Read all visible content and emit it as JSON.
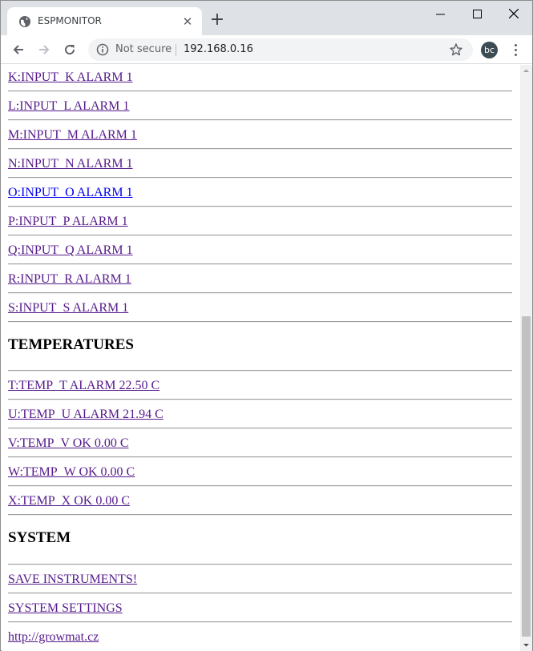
{
  "browser": {
    "tab_title": "ESPMONITOR",
    "tab_close": "✕",
    "new_tab": "+",
    "security_label": "Not secure",
    "url": "192.168.0.16",
    "profile_initials": "bc"
  },
  "page": {
    "input_links": [
      "K:INPUT_K ALARM 1",
      "L:INPUT_L ALARM 1",
      "M:INPUT_M ALARM 1",
      "N:INPUT_N ALARM 1",
      "O:INPUT_O ALARM 1",
      "P:INPUT_P ALARM 1",
      "Q:INPUT_Q ALARM 1",
      "R:INPUT_R ALARM 1",
      "S:INPUT_S ALARM 1"
    ],
    "temperatures_heading": "TEMPERATURES",
    "temperature_links": [
      "T:TEMP_T ALARM 22.50 C",
      "U:TEMP_U ALARM 21.94 C",
      "V:TEMP_V OK 0.00 C",
      "W:TEMP_W OK 0.00 C",
      "X:TEMP_X OK 0.00 C"
    ],
    "system_heading": "SYSTEM",
    "system_links": [
      "SAVE INSTRUMENTS!",
      "SYSTEM SETTINGS"
    ],
    "footer_link": "http://growmat.cz"
  },
  "colors": {
    "visited_link": "#551a8b",
    "unvisited_link": "#0000ee",
    "tabstrip_bg": "#dee1e6"
  }
}
